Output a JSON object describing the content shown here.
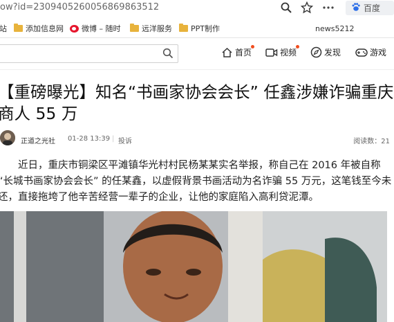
{
  "browser": {
    "url": "ow?id=2309405260056869863512",
    "search_engine_label": "百度"
  },
  "bookmarks": {
    "items": [
      {
        "label": "站",
        "icon": "folder-icon"
      },
      {
        "label": "添加信息网",
        "icon": "folder-icon"
      },
      {
        "label": "微博 – 随时",
        "icon": "weibo-icon"
      },
      {
        "label": "远洋服务",
        "icon": "folder-icon"
      },
      {
        "label": "PPT制作",
        "icon": "folder-icon"
      }
    ],
    "user": "news5212"
  },
  "site_nav": {
    "items": [
      {
        "label": "首页",
        "icon": "home-icon"
      },
      {
        "label": "视频",
        "icon": "video-icon"
      },
      {
        "label": "发现",
        "icon": "compass-icon"
      },
      {
        "label": "游戏",
        "icon": "gamepad-icon"
      }
    ]
  },
  "article": {
    "title": "【重磅曝光】知名“书画家协会会长” 任鑫涉嫌诈骗重庆商人 55 万",
    "author": "正道之光社",
    "time": "01-28 13:39",
    "separator": "|",
    "report": "投诉",
    "reads": "阅读数：21",
    "paragraph": "近日，重庆市铜梁区平滩镇华光村村民杨某某实名举报，称自己在 2016 年被自称 “长城书画家协会会长” 的任某鑫，以虚假背景书画活动为名诈骗 55 万元，这笔钱至今未还，直接拖垮了他辛苦经营一辈子的企业，让他的家庭陷入高利贷泥潭。"
  },
  "colors": {
    "accent_dot": "#f04d1e",
    "folder": "#e8b33c",
    "weibo": "#e6162d"
  }
}
